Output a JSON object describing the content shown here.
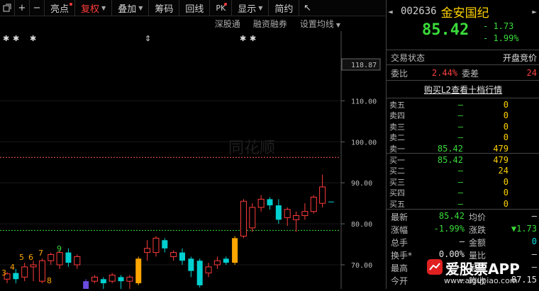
{
  "toolbar": {
    "icon_window": "window-icon",
    "icon_plus": "+",
    "icon_minus": "−",
    "liangdian": "亮点",
    "fuquan": "复权",
    "diejia": "叠加",
    "chouma": "筹码",
    "huixian": "回线",
    "pk": "PK",
    "xianshi": "显示",
    "jianyue": "简约",
    "collapse_icon": "↖"
  },
  "subbar": {
    "shenshen": "深股通",
    "rongzi": "融资融券",
    "shezhi": "设置均线"
  },
  "stock": {
    "code": "002636",
    "name": "金安国纪",
    "price": "85.42",
    "change": "- 1.73",
    "change_pct": "- 1.99%",
    "nav_left": "◄",
    "nav_right": "►"
  },
  "status": {
    "label": "交易状态",
    "value": "开盘竞价"
  },
  "weibi": {
    "label1": "委比",
    "value1": "2.44%",
    "label2": "委差",
    "value2": "24"
  },
  "l2_link": "购买L2查看十档行情",
  "sell_orders": [
    {
      "label": "卖五",
      "price": "—",
      "volume": "0"
    },
    {
      "label": "卖四",
      "price": "—",
      "volume": "0"
    },
    {
      "label": "卖三",
      "price": "—",
      "volume": "0"
    },
    {
      "label": "卖二",
      "price": "—",
      "volume": "0"
    },
    {
      "label": "卖一",
      "price": "85.42",
      "volume": "479"
    }
  ],
  "buy_orders": [
    {
      "label": "买一",
      "price": "85.42",
      "volume": "479"
    },
    {
      "label": "买二",
      "price": "—",
      "volume": "24"
    },
    {
      "label": "买三",
      "price": "—",
      "volume": "0"
    },
    {
      "label": "买四",
      "price": "—",
      "volume": "0"
    },
    {
      "label": "买五",
      "price": "—",
      "volume": "0"
    }
  ],
  "stats": {
    "zuixin_l": "最新",
    "zuixin_v": "85.42",
    "junjia_l": "均价",
    "junjia_v": "—",
    "zhangfu_l": "涨幅",
    "zhangfu_v": "-1.99%",
    "zhangdie_l": "涨跌",
    "zhangdie_v": "▼1.73",
    "zongshou_l": "总手",
    "zongshou_v": "—",
    "jine_l": "金额",
    "jine_v": "0",
    "huanshou_l": "换手*",
    "huanshou_v": "0.00%",
    "liangbi_l": "量比",
    "liangbi_v": "—",
    "zuigao_l": "最高",
    "zuigao_v": "—",
    "zuidi_l": "最低",
    "zuidi_v": "—",
    "jinkai_l": "今开",
    "jinkai_v": "—",
    "zuoshou_l": "昨收",
    "zuoshou_v": "87.15"
  },
  "watermark": {
    "brand": "爱股票APP",
    "url": "www.aigupiao.com"
  },
  "chart_data": {
    "type": "candlestick",
    "y_ticks": [
      "118.87",
      "110.00",
      "100.00",
      "90.00",
      "80.00",
      "70.00"
    ],
    "ylim": [
      65,
      125
    ],
    "price_line_value": 118.87,
    "ref_lines": [
      {
        "value": 96.2,
        "color": "#ff5a5a"
      },
      {
        "value": 78.4,
        "color": "#3adb3a"
      }
    ],
    "markers": [
      "✱",
      "✱",
      "✱",
      "⇕",
      "✱",
      "✱"
    ],
    "wave_labels": [
      "3",
      "4",
      "5",
      "6",
      "7",
      "8",
      "9"
    ],
    "watermark_text": "同花顺",
    "candles": [
      {
        "o": 66.5,
        "c": 67.8,
        "h": 68.2,
        "l": 65.5
      },
      {
        "o": 68.0,
        "c": 66.5,
        "h": 69.0,
        "l": 65.5
      },
      {
        "o": 67.0,
        "c": 69.5,
        "h": 70.5,
        "l": 66.0
      },
      {
        "o": 69.5,
        "c": 70.0,
        "h": 71.0,
        "l": 66.0
      },
      {
        "o": 66.0,
        "c": 71.0,
        "h": 71.5,
        "l": 65.5
      },
      {
        "o": 71.0,
        "c": 72.5,
        "h": 73.0,
        "l": 70.0
      },
      {
        "o": 70.0,
        "c": 73.0,
        "h": 73.5,
        "l": 69.0
      },
      {
        "o": 73.0,
        "c": 70.5,
        "h": 74.0,
        "l": 69.5
      },
      {
        "o": 70.0,
        "c": 72.0,
        "h": 72.5,
        "l": 69.0
      },
      {
        "o": 66.0,
        "c": 64.0,
        "h": 66.5,
        "l": 63.5
      },
      {
        "o": 66.0,
        "c": 67.0,
        "h": 67.5,
        "l": 65.5
      },
      {
        "o": 66.5,
        "c": 65.5,
        "h": 67.0,
        "l": 64.0
      },
      {
        "o": 66.0,
        "c": 67.5,
        "h": 68.0,
        "l": 65.5
      },
      {
        "o": 67.0,
        "c": 66.0,
        "h": 67.5,
        "l": 64.0
      },
      {
        "o": 66.0,
        "c": 67.0,
        "h": 67.5,
        "l": 64.0
      },
      {
        "o": 65.5,
        "c": 71.5,
        "h": 72.0,
        "l": 65.0
      },
      {
        "o": 73.0,
        "c": 74.0,
        "h": 76.0,
        "l": 71.0
      },
      {
        "o": 73.0,
        "c": 76.5,
        "h": 77.0,
        "l": 72.0
      },
      {
        "o": 76.0,
        "c": 74.0,
        "h": 76.5,
        "l": 73.0
      },
      {
        "o": 72.0,
        "c": 73.0,
        "h": 73.5,
        "l": 71.0
      },
      {
        "o": 73.0,
        "c": 71.0,
        "h": 74.0,
        "l": 70.0
      },
      {
        "o": 71.5,
        "c": 68.5,
        "h": 72.0,
        "l": 67.0
      },
      {
        "o": 71.0,
        "c": 65.0,
        "h": 71.5,
        "l": 64.5
      },
      {
        "o": 68.0,
        "c": 69.5,
        "h": 70.5,
        "l": 67.0
      },
      {
        "o": 70.0,
        "c": 71.0,
        "h": 72.0,
        "l": 69.0
      },
      {
        "o": 71.5,
        "c": 70.5,
        "h": 72.0,
        "l": 70.0
      },
      {
        "o": 70.5,
        "c": 76.5,
        "h": 77.0,
        "l": 70.0
      },
      {
        "o": 77.0,
        "c": 85.5,
        "h": 86.0,
        "l": 76.5
      },
      {
        "o": 79.0,
        "c": 84.0,
        "h": 85.0,
        "l": 78.0
      },
      {
        "o": 84.0,
        "c": 86.0,
        "h": 87.0,
        "l": 83.0
      },
      {
        "o": 86.0,
        "c": 84.5,
        "h": 86.5,
        "l": 83.5
      },
      {
        "o": 84.5,
        "c": 81.0,
        "h": 86.0,
        "l": 80.0
      },
      {
        "o": 81.5,
        "c": 83.5,
        "h": 84.0,
        "l": 79.5
      },
      {
        "o": 81.0,
        "c": 82.0,
        "h": 83.0,
        "l": 78.0
      },
      {
        "o": 82.0,
        "c": 83.0,
        "h": 85.0,
        "l": 81.0
      },
      {
        "o": 83.0,
        "c": 86.5,
        "h": 87.0,
        "l": 82.5
      },
      {
        "o": 85.0,
        "c": 89.0,
        "h": 92.0,
        "l": 84.0
      },
      {
        "o": 85.42,
        "c": 85.42,
        "h": 85.42,
        "l": 85.42
      }
    ]
  }
}
